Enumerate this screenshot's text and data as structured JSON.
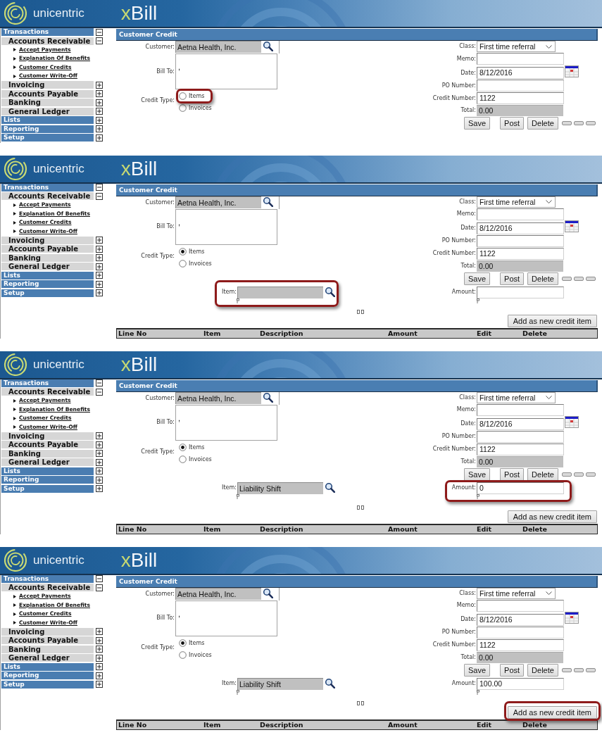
{
  "panels": [
    {
      "header": {
        "brand": "unicentric",
        "product_prefix": "x",
        "product_name": "Bill"
      },
      "sidebar": [
        {
          "label": "Transactions",
          "expanded": true,
          "children": [
            {
              "label": "Accounts Receivable",
              "expanded": true,
              "children": [
                {
                  "label": "Accept Payments"
                },
                {
                  "label": "Explanation Of Benefits"
                },
                {
                  "label": "Customer Credits"
                },
                {
                  "label": "Customer Write-Off"
                }
              ]
            },
            {
              "label": "Invoicing",
              "expanded": false
            },
            {
              "label": "Accounts Payable",
              "expanded": false
            },
            {
              "label": "Banking",
              "expanded": false
            },
            {
              "label": "General Ledger",
              "expanded": false
            }
          ]
        },
        {
          "label": "Lists",
          "expanded": false
        },
        {
          "label": "Reporting",
          "expanded": false
        },
        {
          "label": "Setup",
          "expanded": false
        }
      ],
      "title": "Customer Credit",
      "form": {
        "customer": {
          "label": "Customer:",
          "value": "Aetna Health, Inc."
        },
        "bill_to": {
          "label": "Bill To:",
          "value": ","
        },
        "credit_type": {
          "label": "Credit Type:",
          "highlighted": true,
          "options": [
            {
              "label": "Items",
              "selected": false
            },
            {
              "label": "Invoices",
              "selected": false
            }
          ]
        },
        "class": {
          "label": "Class:",
          "value": "First time referral"
        },
        "memo": {
          "label": "Memo:"
        },
        "date": {
          "label": "Date:",
          "value": "8/12/2016"
        },
        "po_number": {
          "label": "PO Number:"
        },
        "credit_number": {
          "label": "Credit Number:",
          "value": "1122"
        },
        "total": {
          "label": "Total:",
          "value": "0.00"
        }
      },
      "buttons": [
        {
          "kind": "text",
          "label": "Save"
        },
        {
          "kind": "text",
          "label": "Post"
        },
        {
          "kind": "text",
          "label": "Delete"
        },
        {
          "kind": "blank"
        },
        {
          "kind": "blank"
        },
        {
          "kind": "blank"
        }
      ]
    },
    {
      "header": {
        "brand": "unicentric",
        "product_prefix": "x",
        "product_name": "Bill"
      },
      "sidebar": [
        {
          "label": "Transactions",
          "expanded": true,
          "children": [
            {
              "label": "Accounts Receivable",
              "expanded": true,
              "children": [
                {
                  "label": "Accept Payments"
                },
                {
                  "label": "Explanation Of Benefits"
                },
                {
                  "label": "Customer Credits"
                },
                {
                  "label": "Customer Write-Off"
                }
              ]
            },
            {
              "label": "Invoicing",
              "expanded": false
            },
            {
              "label": "Accounts Payable",
              "expanded": false
            },
            {
              "label": "Banking",
              "expanded": false
            },
            {
              "label": "General Ledger",
              "expanded": false
            }
          ]
        },
        {
          "label": "Lists",
          "expanded": false
        },
        {
          "label": "Reporting",
          "expanded": false
        },
        {
          "label": "Setup",
          "expanded": false
        }
      ],
      "title": "Customer Credit",
      "form": {
        "customer": {
          "label": "Customer:",
          "value": "Aetna Health, Inc."
        },
        "bill_to": {
          "label": "Bill To:",
          "value": ","
        },
        "credit_type": {
          "label": "Credit Type:",
          "highlighted": false,
          "options": [
            {
              "label": "Items",
              "selected": true
            },
            {
              "label": "Invoices",
              "selected": false
            }
          ]
        },
        "class": {
          "label": "Class:",
          "value": "First time referral"
        },
        "memo": {
          "label": "Memo:"
        },
        "date": {
          "label": "Date:",
          "value": "8/12/2016"
        },
        "po_number": {
          "label": "PO Number:"
        },
        "credit_number": {
          "label": "Credit Number:",
          "value": "1122"
        },
        "total": {
          "label": "Total:",
          "value": "0.00"
        }
      },
      "buttons": [
        {
          "kind": "text",
          "label": "Save"
        },
        {
          "kind": "text",
          "label": "Post"
        },
        {
          "kind": "text",
          "label": "Delete"
        },
        {
          "kind": "blank"
        },
        {
          "kind": "blank"
        },
        {
          "kind": "blank"
        }
      ],
      "credit_item": {
        "item": {
          "label": "Item:",
          "highlighted": true
        },
        "amount": {
          "label": "Amount:",
          "highlighted": false
        },
        "add_button": {
          "label": "Add as new credit item",
          "highlighted": false
        }
      },
      "table": {
        "columns": [
          "Line No",
          "Item",
          "Description",
          "Amount",
          "Edit",
          "Delete"
        ]
      }
    },
    {
      "header": {
        "brand": "unicentric",
        "product_prefix": "x",
        "product_name": "Bill"
      },
      "sidebar": [
        {
          "label": "Transactions",
          "expanded": true,
          "children": [
            {
              "label": "Accounts Receivable",
              "expanded": true,
              "children": [
                {
                  "label": "Accept Payments"
                },
                {
                  "label": "Explanation Of Benefits"
                },
                {
                  "label": "Customer Credits"
                },
                {
                  "label": "Customer Write-Off"
                }
              ]
            },
            {
              "label": "Invoicing",
              "expanded": false
            },
            {
              "label": "Accounts Payable",
              "expanded": false
            },
            {
              "label": "Banking",
              "expanded": false
            },
            {
              "label": "General Ledger",
              "expanded": false
            }
          ]
        },
        {
          "label": "Lists",
          "expanded": false
        },
        {
          "label": "Reporting",
          "expanded": false
        },
        {
          "label": "Setup",
          "expanded": false
        }
      ],
      "title": "Customer Credit",
      "form": {
        "customer": {
          "label": "Customer:",
          "value": "Aetna Health, Inc."
        },
        "bill_to": {
          "label": "Bill To:",
          "value": ","
        },
        "credit_type": {
          "label": "Credit Type:",
          "highlighted": false,
          "options": [
            {
              "label": "Items",
              "selected": true
            },
            {
              "label": "Invoices",
              "selected": false
            }
          ]
        },
        "class": {
          "label": "Class:",
          "value": "First time referral"
        },
        "memo": {
          "label": "Memo:"
        },
        "date": {
          "label": "Date:",
          "value": "8/12/2016"
        },
        "po_number": {
          "label": "PO Number:"
        },
        "credit_number": {
          "label": "Credit Number:",
          "value": "1122"
        },
        "total": {
          "label": "Total:",
          "value": "0.00"
        }
      },
      "buttons": [
        {
          "kind": "text",
          "label": "Save"
        },
        {
          "kind": "text",
          "label": "Post"
        },
        {
          "kind": "text",
          "label": "Delete"
        },
        {
          "kind": "blank"
        },
        {
          "kind": "blank"
        },
        {
          "kind": "blank"
        }
      ],
      "credit_item": {
        "item": {
          "label": "Item:",
          "value": "Liability Shift",
          "highlighted": false
        },
        "amount": {
          "label": "Amount:",
          "value": "0",
          "highlighted": true
        },
        "add_button": {
          "label": "Add as new credit item",
          "highlighted": false
        }
      },
      "table": {
        "columns": [
          "Line No",
          "Item",
          "Description",
          "Amount",
          "Edit",
          "Delete"
        ]
      }
    },
    {
      "header": {
        "brand": "unicentric",
        "product_prefix": "x",
        "product_name": "Bill"
      },
      "sidebar": [
        {
          "label": "Transactions",
          "expanded": true,
          "children": [
            {
              "label": "Accounts Receivable",
              "expanded": true,
              "children": [
                {
                  "label": "Accept Payments"
                },
                {
                  "label": "Explanation Of Benefits"
                },
                {
                  "label": "Customer Credits"
                },
                {
                  "label": "Customer Write-Off"
                }
              ]
            },
            {
              "label": "Invoicing",
              "expanded": false
            },
            {
              "label": "Accounts Payable",
              "expanded": false
            },
            {
              "label": "Banking",
              "expanded": false
            },
            {
              "label": "General Ledger",
              "expanded": false
            }
          ]
        },
        {
          "label": "Lists",
          "expanded": false
        },
        {
          "label": "Reporting",
          "expanded": false
        },
        {
          "label": "Setup",
          "expanded": false
        }
      ],
      "title": "Customer Credit",
      "form": {
        "customer": {
          "label": "Customer:",
          "value": "Aetna Health, Inc."
        },
        "bill_to": {
          "label": "Bill To:",
          "value": ","
        },
        "credit_type": {
          "label": "Credit Type:",
          "highlighted": false,
          "options": [
            {
              "label": "Items",
              "selected": true
            },
            {
              "label": "Invoices",
              "selected": false
            }
          ]
        },
        "class": {
          "label": "Class:",
          "value": "First time referral"
        },
        "memo": {
          "label": "Memo:"
        },
        "date": {
          "label": "Date:",
          "value": "8/12/2016"
        },
        "po_number": {
          "label": "PO Number:"
        },
        "credit_number": {
          "label": "Credit Number:",
          "value": "1122"
        },
        "total": {
          "label": "Total:",
          "value": "0.00"
        }
      },
      "buttons": [
        {
          "kind": "text",
          "label": "Save"
        },
        {
          "kind": "text",
          "label": "Post"
        },
        {
          "kind": "text",
          "label": "Delete"
        },
        {
          "kind": "blank"
        },
        {
          "kind": "blank"
        },
        {
          "kind": "blank"
        }
      ],
      "credit_item": {
        "item": {
          "label": "Item:",
          "value": "Liability Shift",
          "highlighted": false
        },
        "amount": {
          "label": "Amount:",
          "value": "100.00",
          "highlighted": false
        },
        "add_button": {
          "label": "Add as new credit item",
          "highlighted": true
        }
      },
      "table": {
        "columns": [
          "Line No",
          "Item",
          "Description",
          "Amount",
          "Edit",
          "Delete"
        ]
      }
    }
  ]
}
